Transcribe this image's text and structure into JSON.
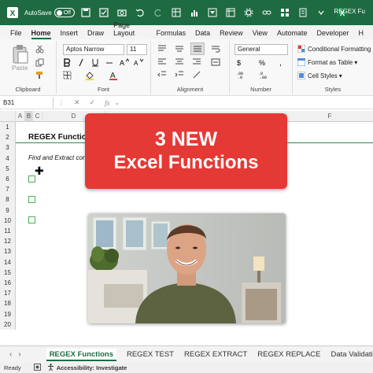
{
  "titlebar": {
    "autosave_label": "AutoSave",
    "autosave_state": "Off",
    "title": "REGEX Fu"
  },
  "menu": {
    "tabs": [
      "File",
      "Home",
      "Insert",
      "Draw",
      "Page Layout",
      "Formulas",
      "Data",
      "Review",
      "View",
      "Automate",
      "Developer",
      "H"
    ],
    "active": "Home"
  },
  "ribbon": {
    "clipboard_label": "Clipboard",
    "paste_label": "Paste",
    "font_label": "Font",
    "font_name": "Aptos Narrow",
    "font_size": "11",
    "alignment_label": "Alignment",
    "number_label": "Number",
    "number_format": "General",
    "styles_label": "Styles",
    "conditional_formatting": "Conditional Formatting",
    "format_as_table": "Format as Table",
    "cell_styles": "Cell Styles"
  },
  "formula_bar": {
    "name_box": "B31",
    "fx": "fx"
  },
  "grid": {
    "columns": [
      "A",
      "B",
      "C",
      "D",
      "E",
      "F"
    ],
    "rows": [
      "1",
      "2",
      "3",
      "4",
      "5",
      "6",
      "7",
      "8",
      "9",
      "10",
      "11",
      "12",
      "13",
      "14",
      "15",
      "16",
      "17",
      "18",
      "19",
      "20"
    ],
    "cells": {
      "title": "REGEX Functions",
      "subtitle": "Find and Extract content"
    }
  },
  "overlay": {
    "line1": "3 NEW",
    "line2": "Excel Functions",
    "color": "#e53935"
  },
  "sheets": {
    "tabs": [
      "REGEX Functions",
      "REGEX TEST",
      "REGEX EXTRACT",
      "REGEX REPLACE",
      "Data Validation"
    ],
    "active": "REGEX Functions"
  },
  "status": {
    "ready": "Ready",
    "accessibility": "Accessibility: Investigate"
  },
  "colors": {
    "brand_green": "#1e6b42",
    "banner_red": "#e53935",
    "checkbox_green": "#4caf50"
  }
}
